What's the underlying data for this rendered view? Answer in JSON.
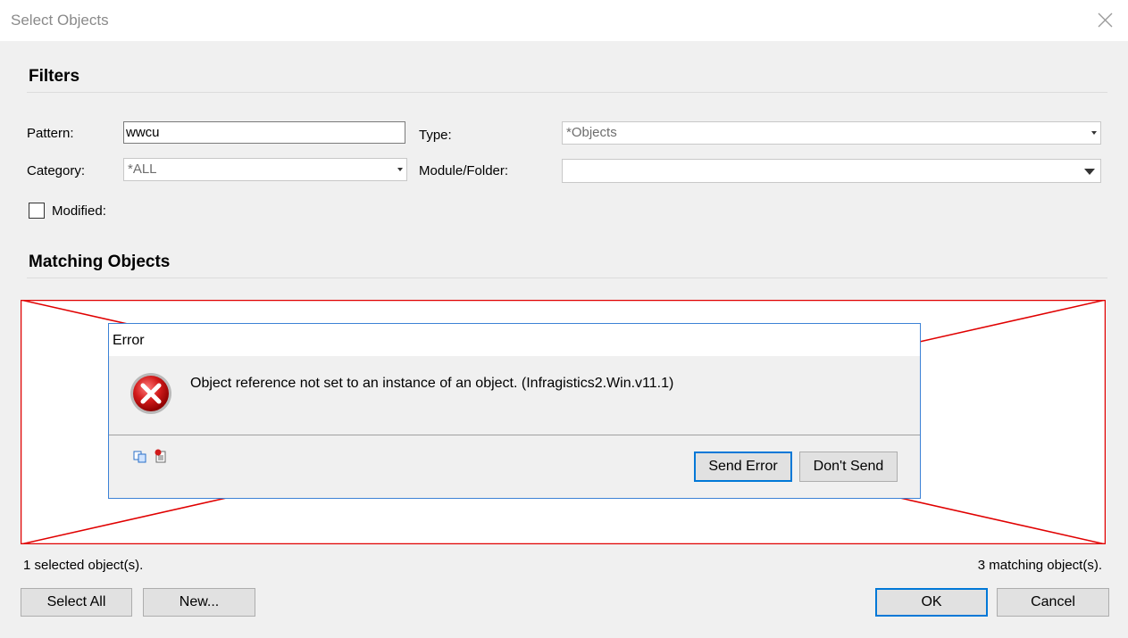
{
  "window": {
    "title": "Select Objects"
  },
  "filters": {
    "heading": "Filters",
    "pattern_label": "Pattern:",
    "pattern_value": "wwcu",
    "type_label": "Type:",
    "type_value": "*Objects",
    "category_label": "Category:",
    "category_value": "*ALL",
    "module_label": "Module/Folder:",
    "module_value": "",
    "modified_label": "Modified:"
  },
  "matching": {
    "heading": "Matching Objects"
  },
  "error_dialog": {
    "title": "Error",
    "message": "Object reference not set to an instance of an object. (Infragistics2.Win.v11.1)",
    "send_label": "Send Error",
    "dont_send_label": "Don't Send"
  },
  "status": {
    "selected": "1 selected object(s).",
    "matching": "3 matching object(s)."
  },
  "buttons": {
    "select_all": "Select All",
    "new": "New...",
    "ok": "OK",
    "cancel": "Cancel"
  },
  "colors": {
    "error_cross": "#e00000",
    "accent": "#0078d7",
    "error_icon": "#c8102e"
  }
}
